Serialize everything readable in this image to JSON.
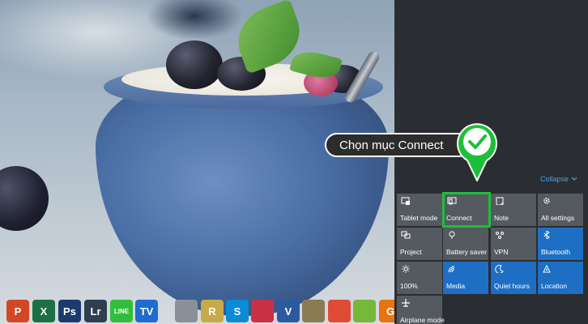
{
  "callout": {
    "text": "Chọn mục Connect"
  },
  "action_center": {
    "collapse_label": "Collapse",
    "tiles": [
      {
        "label": "Tablet mode",
        "icon": "tablet-mode-icon",
        "active": false
      },
      {
        "label": "Connect",
        "icon": "connect-icon",
        "active": false
      },
      {
        "label": "Note",
        "icon": "note-icon",
        "active": false
      },
      {
        "label": "All settings",
        "icon": "gear-icon",
        "active": false
      },
      {
        "label": "Project",
        "icon": "project-icon",
        "active": false
      },
      {
        "label": "Battery saver",
        "icon": "battery-saver-icon",
        "active": false
      },
      {
        "label": "VPN",
        "icon": "vpn-icon",
        "active": false
      },
      {
        "label": "Bluetooth",
        "icon": "bluetooth-icon",
        "active": true
      },
      {
        "label": "100%",
        "icon": "brightness-icon",
        "active": false
      },
      {
        "label": "Media",
        "icon": "media-icon",
        "active": true
      },
      {
        "label": "Quiet hours",
        "icon": "moon-icon",
        "active": true
      },
      {
        "label": "Location",
        "icon": "location-icon",
        "active": true
      },
      {
        "label": "Airplane mode",
        "icon": "airplane-icon",
        "active": false
      }
    ]
  },
  "taskbar": {
    "icons": [
      {
        "name": "powerpoint-icon",
        "text": "P",
        "color": "#d24726"
      },
      {
        "name": "excel-icon",
        "text": "X",
        "color": "#1d7044"
      },
      {
        "name": "photoshop-icon",
        "text": "Ps",
        "color": "#1c3a6d"
      },
      {
        "name": "lightroom-icon",
        "text": "Lr",
        "color": "#2e3f52"
      },
      {
        "name": "line-icon",
        "text": "LINE",
        "color": "#2fbf3a"
      },
      {
        "name": "teamviewer-icon",
        "text": "TV",
        "color": "#1f6bd1"
      },
      {
        "name": "disk-utility-icon",
        "text": "",
        "color": "#8a9098"
      },
      {
        "name": "rar-icon",
        "text": "R",
        "color": "#c9a94a"
      },
      {
        "name": "skype-icon",
        "text": "S",
        "color": "#0a8bd6"
      },
      {
        "name": "cyberlink-icon",
        "text": "",
        "color": "#c93045"
      },
      {
        "name": "uv-icon",
        "text": "V",
        "color": "#2c5aa0"
      },
      {
        "name": "dvd-icon",
        "text": "",
        "color": "#8a7b55"
      },
      {
        "name": "chrome-icon",
        "text": "",
        "color": "#e04b36"
      },
      {
        "name": "coccoc-icon",
        "text": "",
        "color": "#76b83a"
      },
      {
        "name": "pdf-icon",
        "text": "G",
        "color": "#e8730f"
      }
    ]
  }
}
